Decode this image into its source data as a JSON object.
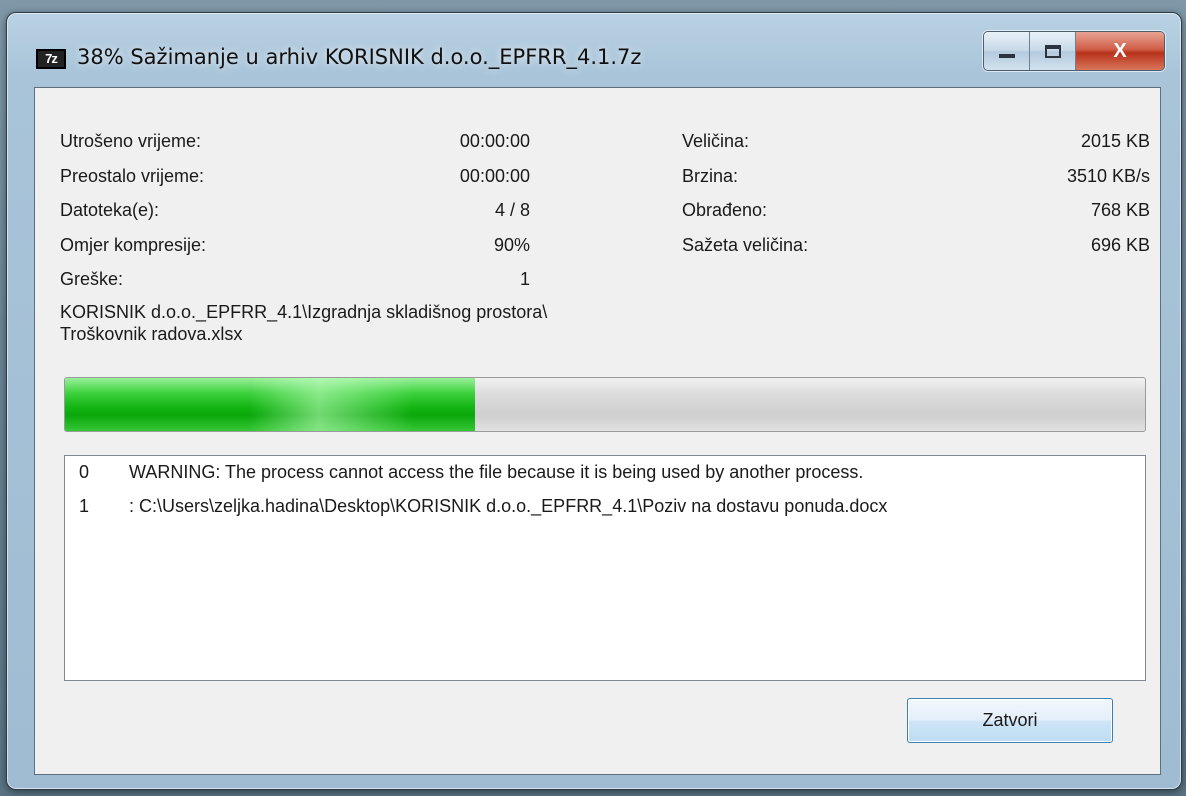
{
  "window": {
    "title": "38% Sažimanje u arhiv KORISNIK d.o.o._EPFRR_4.1.7z",
    "app_icon_text": "7z",
    "buttons": {
      "minimize": "minimize-icon",
      "maximize": "maximize-icon",
      "close": "X"
    }
  },
  "stats_left": [
    {
      "label": "Utrošeno vrijeme:",
      "value": "00:00:00"
    },
    {
      "label": "Preostalo vrijeme:",
      "value": "00:00:00"
    },
    {
      "label": "Datoteka(e):",
      "value": "4 / 8"
    },
    {
      "label": "Omjer kompresije:",
      "value": "90%"
    },
    {
      "label": "Greške:",
      "value": "1"
    }
  ],
  "stats_right": [
    {
      "label": "Veličina:",
      "value": "2015 KB"
    },
    {
      "label": "Brzina:",
      "value": "3510 KB/s"
    },
    {
      "label": "Obrađeno:",
      "value": "768 KB"
    },
    {
      "label": "Sažeta veličina:",
      "value": "696 KB"
    }
  ],
  "current_file": {
    "line1": "KORISNIK d.o.o._EPFRR_4.1\\Izgradnja skladišnog prostora\\",
    "line2": "Troškovnik radova.xlsx"
  },
  "progress": {
    "percent": 38,
    "color": "#14b514"
  },
  "log": [
    {
      "index": "0",
      "text": "WARNING: The process cannot access the file because it is being used by another process."
    },
    {
      "index": "1",
      "text": ": C:\\Users\\zeljka.hadina\\Desktop\\KORISNIK d.o.o._EPFRR_4.1\\Poziv na dostavu ponuda.docx"
    }
  ],
  "actions": {
    "close_label": "Zatvori"
  }
}
